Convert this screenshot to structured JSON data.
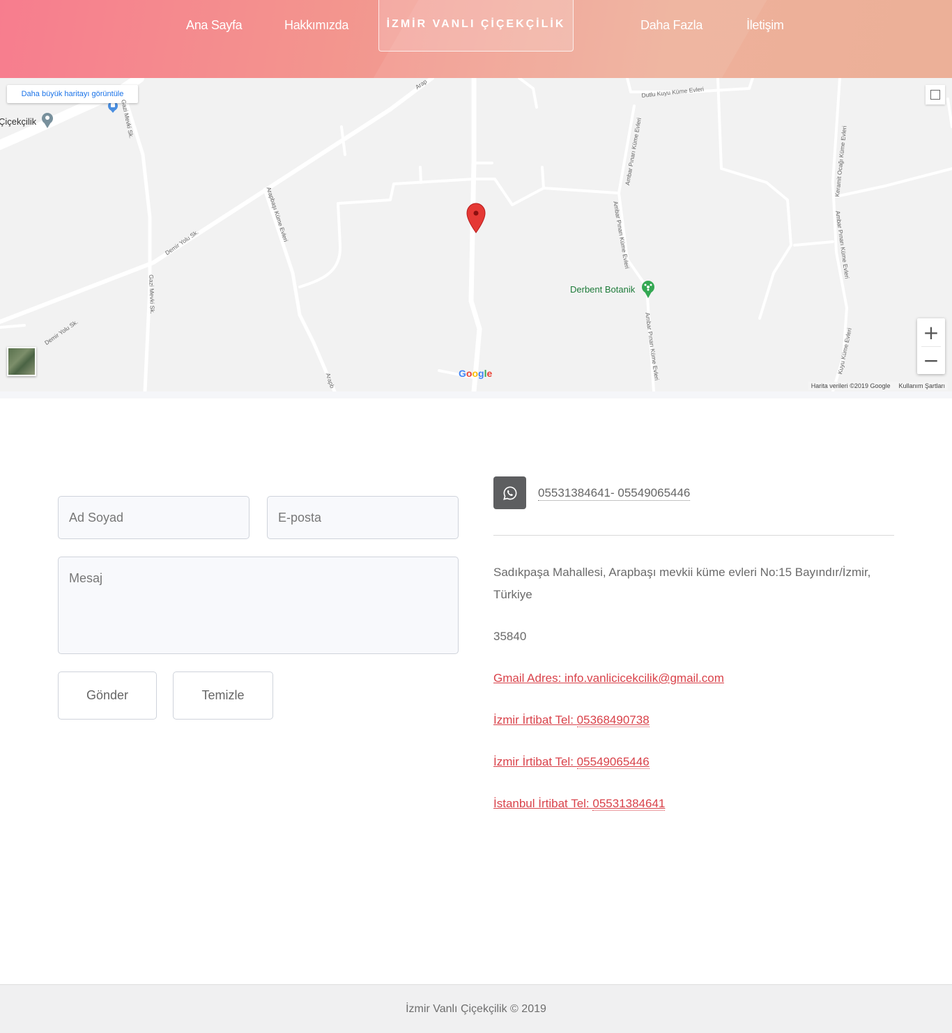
{
  "nav": {
    "items": [
      {
        "label": "Ana Sayfa"
      },
      {
        "label": "Hakkımızda"
      },
      {
        "label": "Daha Fazla"
      },
      {
        "label": "İletişim"
      }
    ],
    "brand": "İZMİR VANLI ÇİÇEKÇİLİK"
  },
  "map": {
    "larger_map_link": "Daha büyük haritayı görüntüle",
    "places": {
      "florist": "Çiçekçilik",
      "botanic": "Derbent Botanik"
    },
    "streets": {
      "gazi_1": "Gazi Mevki Sk.",
      "gazi_2": "Gazi Mevki Sk.",
      "demir_1": "Demir Yolu Sk.",
      "demir_2": "Demir Yolu Sk.",
      "arapbasi_1": "Arapbaşı Küme Evleri",
      "arapbasi_2": "Arapb",
      "arapbasi_3": "Arap",
      "dutlu": "Dutlu Kuyu Küme Evleri",
      "ambar_1": "Ambar Pınarı Küme Evleri",
      "ambar_2": "Ambar Pınarı Küme Evleri",
      "ambar_3": "Ambar Pınarı Küme Evleri",
      "ambar_4": "Ambar Pınarı Küme Evleri",
      "kuyu": "Kuyu Küme Evleri",
      "ocagi": "Keramit Ocağı Küme Evleri"
    },
    "zoom_in": "+",
    "zoom_out": "−",
    "google": {
      "g1": "G",
      "o1": "o",
      "o2": "o",
      "g2": "g",
      "l": "l",
      "e": "e"
    },
    "map_data_credit": "Harita verileri ©2019 Google",
    "terms": "Kullanım Şartları",
    "colors": {
      "marker": "#e53935",
      "roads": "#ffffff",
      "background": "#f2f2f2"
    }
  },
  "form": {
    "name_placeholder": "Ad Soyad",
    "email_placeholder": "E-posta",
    "message_placeholder": "Mesaj",
    "submit_label": "Gönder",
    "reset_label": "Temizle"
  },
  "contact": {
    "whatsapp_icon": "whatsapp-icon",
    "whatsapp_numbers": "05531384641- 05549065446",
    "address_line1": "Sadıkpaşa Mahallesi, Arapbaşı mevkii küme evleri No:15 Bayındır/İzmir,",
    "address_line2": "Türkiye",
    "postal_code": "35840",
    "gmail_label": "Gmail Adres: info.vanlicicekcilik@gmail.com",
    "izmir1_label": "İzmir İrtibat Tel: ",
    "izmir1_number": "05368490738",
    "izmir2_label": "İzmir İrtibat Tel: ",
    "izmir2_number": "05549065446",
    "istanbul_label": "İstanbul İrtibat Tel: ",
    "istanbul_number": "05531384641",
    "link_color": "#d9424a"
  },
  "footer": {
    "copyright": "İzmir Vanlı Çiçekçilik © 2019"
  }
}
